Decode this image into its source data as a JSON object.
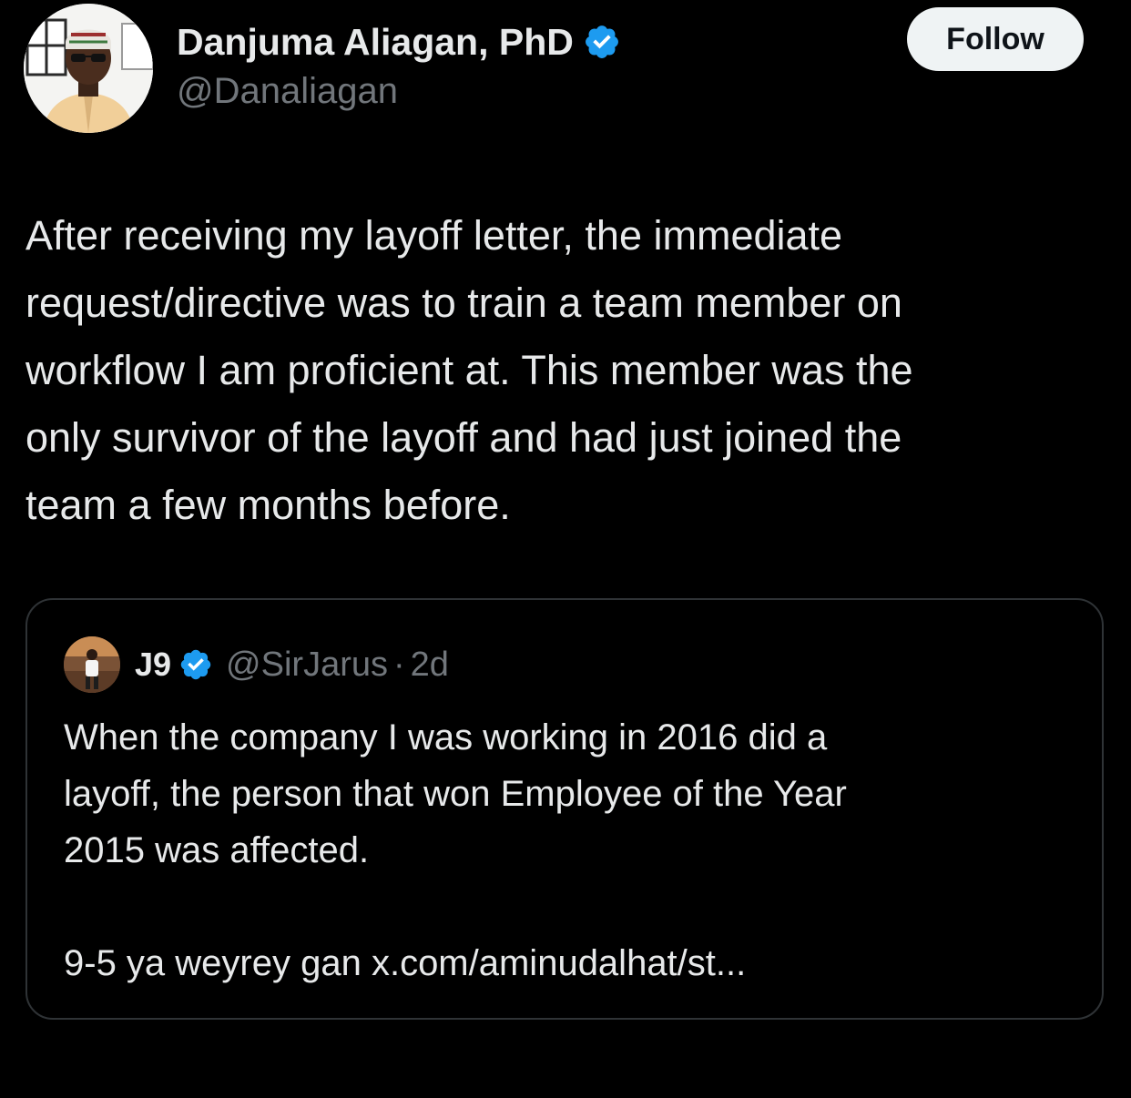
{
  "tweet": {
    "author": {
      "name": "Danjuma Aliagan, PhD",
      "handle": "@Danaliagan",
      "verified": true
    },
    "follow_label": "Follow",
    "text_lines": [
      "After receiving my layoff letter, the immediate",
      "request/directive was to train a team member on",
      "workflow I am proficient at. This member was the",
      "only survivor of the layoff and had just joined the",
      "team a few months before."
    ]
  },
  "quote": {
    "author": {
      "name": "J9",
      "handle": "@SirJarus",
      "separator": "·",
      "time": "2d",
      "verified": true
    },
    "text_lines": [
      "When the company I was working in 2016 did a",
      "layoff, the person that won Employee of the Year",
      "2015 was affected.",
      "",
      "9-5 ya weyrey gan x.com/aminudalhat/st..."
    ]
  },
  "colors": {
    "background": "#000000",
    "primary_text": "#e7e9ea",
    "secondary_text": "#71767b",
    "verified_blue": "#1d9bf0",
    "border": "#2f3336",
    "follow_bg": "#eff3f4"
  },
  "icons": {
    "verified": "verified-badge-icon"
  }
}
